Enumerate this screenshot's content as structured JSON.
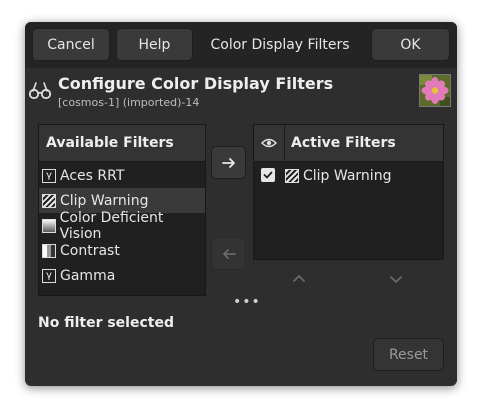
{
  "header": {
    "cancel_label": "Cancel",
    "help_label": "Help",
    "title": "Color Display Filters",
    "ok_label": "OK"
  },
  "configure": {
    "title": "Configure Color Display Filters",
    "subtitle": "[cosmos-1] (imported)-14",
    "icon": "glasses-icon",
    "thumbnail": "image-thumbnail-flower"
  },
  "available": {
    "header": "Available Filters",
    "items": [
      {
        "label": "Aces RRT",
        "icon": "aces-rrt-icon"
      },
      {
        "label": "Clip Warning",
        "icon": "clip-warning-icon",
        "selected": true
      },
      {
        "label": "Color Deficient Vision",
        "icon": "color-deficient-vision-icon"
      },
      {
        "label": "Contrast",
        "icon": "contrast-icon"
      },
      {
        "label": "Gamma",
        "icon": "gamma-icon"
      }
    ]
  },
  "active": {
    "header": "Active Filters",
    "eye_icon": "eye-icon",
    "items": [
      {
        "label": "Clip Warning",
        "checked": true,
        "icon": "clip-warning-icon"
      }
    ]
  },
  "controls": {
    "add_icon": "arrow-right-icon",
    "remove_icon": "arrow-left-icon",
    "up_icon": "chevron-up-icon",
    "down_icon": "chevron-down-icon",
    "more": "•••"
  },
  "status": "No filter selected",
  "reset_label": "Reset",
  "colors": {
    "dialog_bg": "#2e2e2e",
    "header_bg": "#242424",
    "list_bg": "#202020",
    "selected_row": "#3a3a3a",
    "text": "#e6e6e6"
  }
}
